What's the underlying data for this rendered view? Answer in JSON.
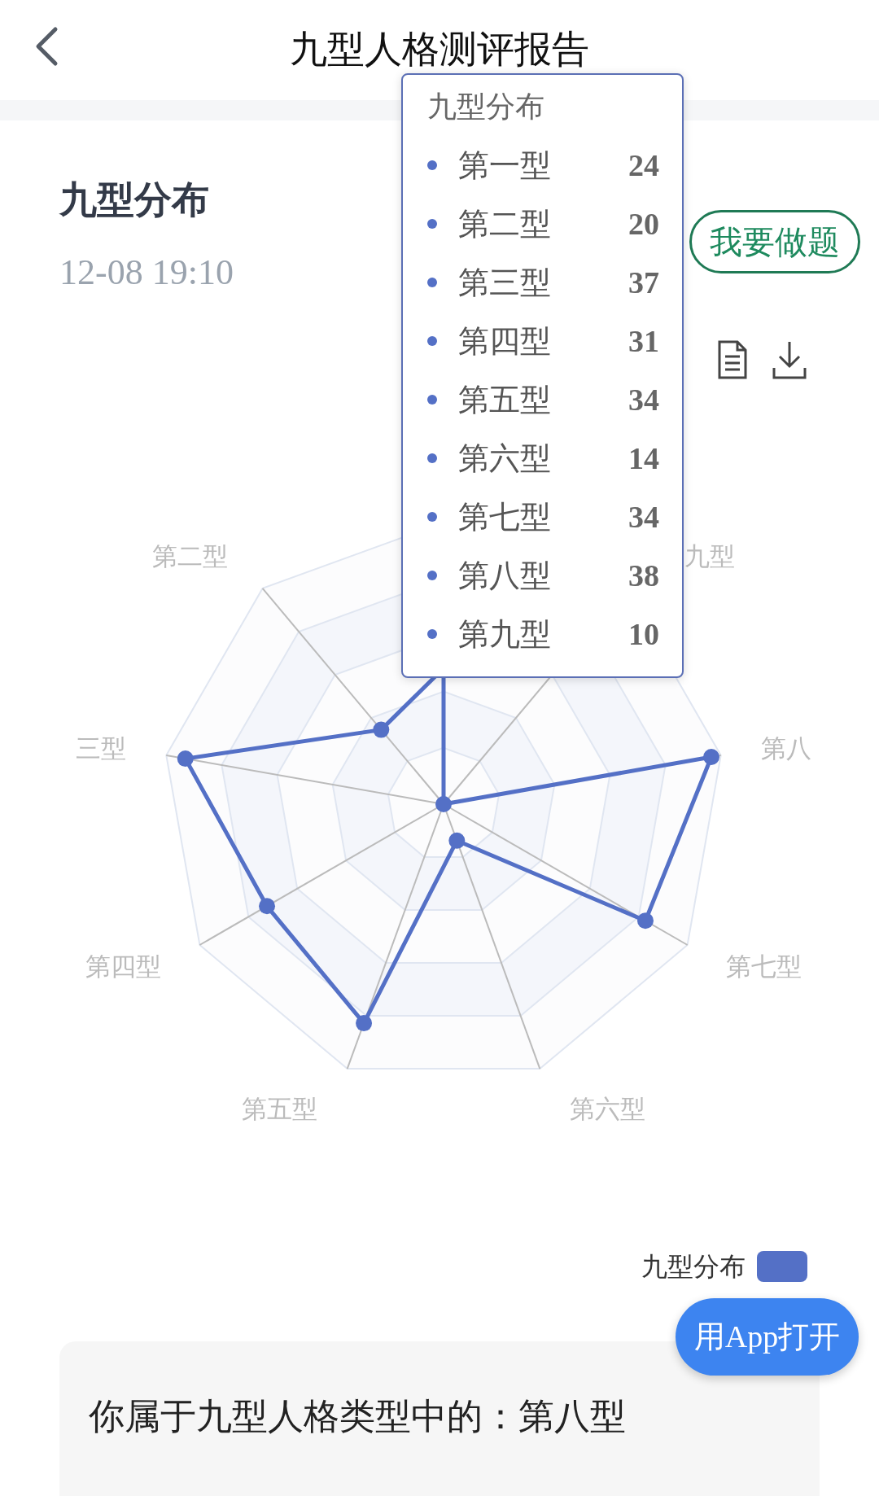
{
  "header": {
    "title": "九型人格测评报告"
  },
  "card": {
    "title": "九型分布",
    "time": "12-08 19:10",
    "action": "我要做题"
  },
  "radar": {
    "axis_labels": [
      {
        "label": "第二型",
        "kind": "full"
      },
      {
        "label": "三型",
        "kind": "cut_start"
      },
      {
        "label": "第四型",
        "kind": "full"
      },
      {
        "label": "第五型",
        "kind": "full"
      },
      {
        "label": "第六型",
        "kind": "full"
      },
      {
        "label": "第七型",
        "kind": "full"
      },
      {
        "label": "第八",
        "kind": "cut_end"
      },
      {
        "label": "九型",
        "kind": "cut_start"
      }
    ]
  },
  "tooltip": {
    "title": "九型分布",
    "items": [
      {
        "name": "第一型",
        "value": "24"
      },
      {
        "name": "第二型",
        "value": "20"
      },
      {
        "name": "第三型",
        "value": "37"
      },
      {
        "name": "第四型",
        "value": "31"
      },
      {
        "name": "第五型",
        "value": "34"
      },
      {
        "name": "第六型",
        "value": "14"
      },
      {
        "name": "第七型",
        "value": "34"
      },
      {
        "name": "第八型",
        "value": "38"
      },
      {
        "name": "第九型",
        "value": "10"
      }
    ]
  },
  "legend": {
    "label": "九型分布"
  },
  "float_button": {
    "label": "用App打开"
  },
  "result": {
    "text": "你属于九型人格类型中的：第八型"
  }
}
